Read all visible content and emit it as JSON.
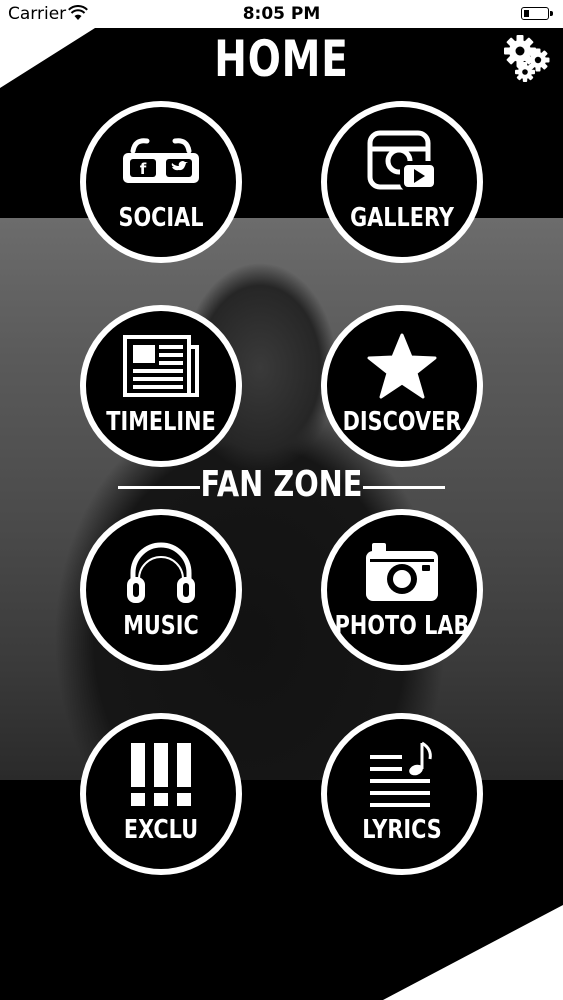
{
  "status_bar": {
    "carrier": "Carrier",
    "time": "8:05 PM"
  },
  "header": {
    "title": "HOME"
  },
  "tiles": [
    {
      "label": "SOCIAL",
      "icon": "social-glasses-icon"
    },
    {
      "label": "GALLERY",
      "icon": "gallery-icon"
    },
    {
      "label": "TIMELINE",
      "icon": "newspaper-icon"
    },
    {
      "label": "DISCOVER",
      "icon": "star-icon"
    },
    {
      "label": "MUSIC",
      "icon": "headphones-icon"
    },
    {
      "label": "PHOTO LAB",
      "icon": "camera-icon"
    },
    {
      "label": "EXCLU",
      "icon": "exclamation-icon"
    },
    {
      "label": "LYRICS",
      "icon": "music-note-lyrics-icon"
    }
  ],
  "section": {
    "fan_zone": "FAN ZONE"
  },
  "colors": {
    "background": "#000000",
    "foreground": "#ffffff"
  }
}
